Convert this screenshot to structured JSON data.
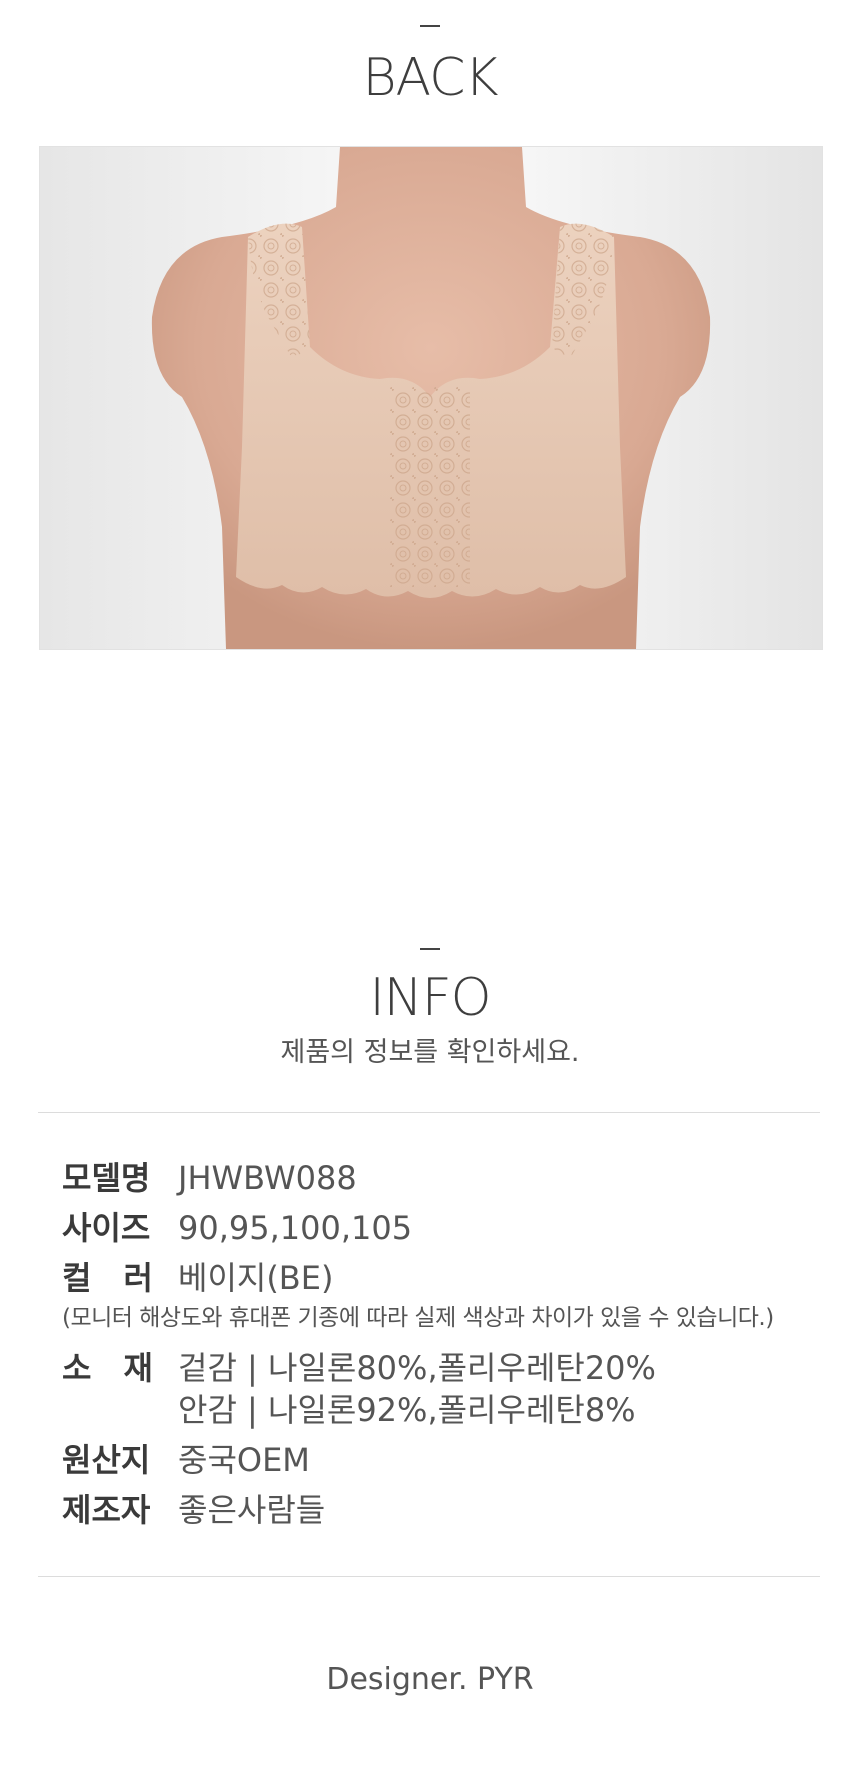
{
  "back_section": {
    "title": "BACK"
  },
  "photo": {
    "alt_icon": "product-back-photo"
  },
  "info_section": {
    "title": "INFO",
    "subtitle": "제품의 정보를 확인하세요."
  },
  "specs": {
    "model": {
      "label": "모델명",
      "value": "JHWBW088"
    },
    "size": {
      "label": "사이즈",
      "value": "90,95,100,105"
    },
    "color": {
      "label": "컬　러",
      "value": "베이지(BE)"
    },
    "color_note": "(모니터 해상도와 휴대폰 기종에 따라 실제 색상과 차이가 있을 수 있습니다.)",
    "material": {
      "label": "소　재",
      "outer": "겉감 | 나일론80%,폴리우레탄20%",
      "inner": "안감 | 나일론92%,폴리우레탄8%"
    },
    "origin": {
      "label": "원산지",
      "value": "중국OEM"
    },
    "maker": {
      "label": "제조자",
      "value": "좋은사람들"
    }
  },
  "footer": {
    "designer": "Designer. PYR"
  },
  "colors": {
    "lace": "#e6c9b4",
    "skin": "#dcae98",
    "background": "#f3f3f3"
  }
}
